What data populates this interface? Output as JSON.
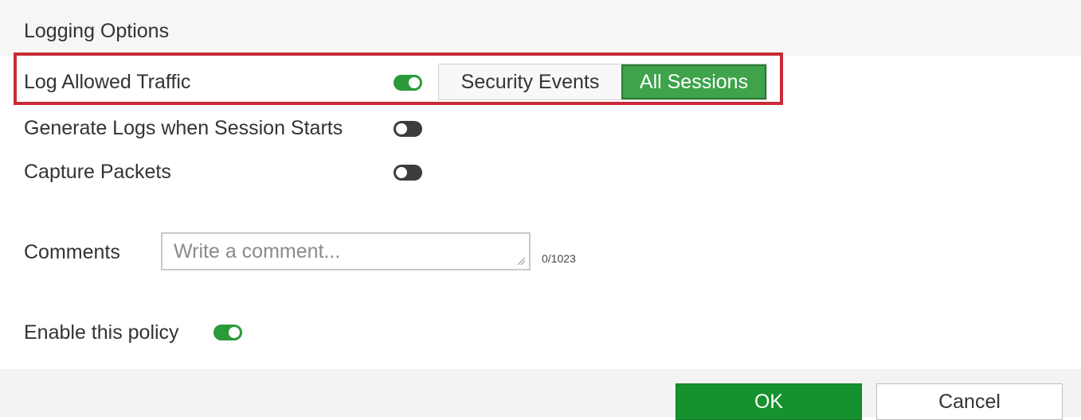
{
  "section": {
    "title": "Logging Options"
  },
  "log_allowed_traffic": {
    "label": "Log Allowed Traffic",
    "enabled": true,
    "options": [
      "Security Events",
      "All Sessions"
    ],
    "selected": "All Sessions"
  },
  "generate_logs": {
    "label": "Generate Logs when Session Starts",
    "enabled": false
  },
  "capture_packets": {
    "label": "Capture Packets",
    "enabled": false
  },
  "comments": {
    "label": "Comments",
    "placeholder": "Write a comment...",
    "value": "",
    "char_count": "0/1023"
  },
  "enable_policy": {
    "label": "Enable this policy",
    "enabled": true
  },
  "footer": {
    "ok_label": "OK",
    "cancel_label": "Cancel"
  },
  "colors": {
    "accent_green": "#3ea34a",
    "toggle_on": "#2b9a3b",
    "toggle_off": "#3c3c3c",
    "highlight_red": "#c72b36",
    "ok_button": "#17912d"
  }
}
